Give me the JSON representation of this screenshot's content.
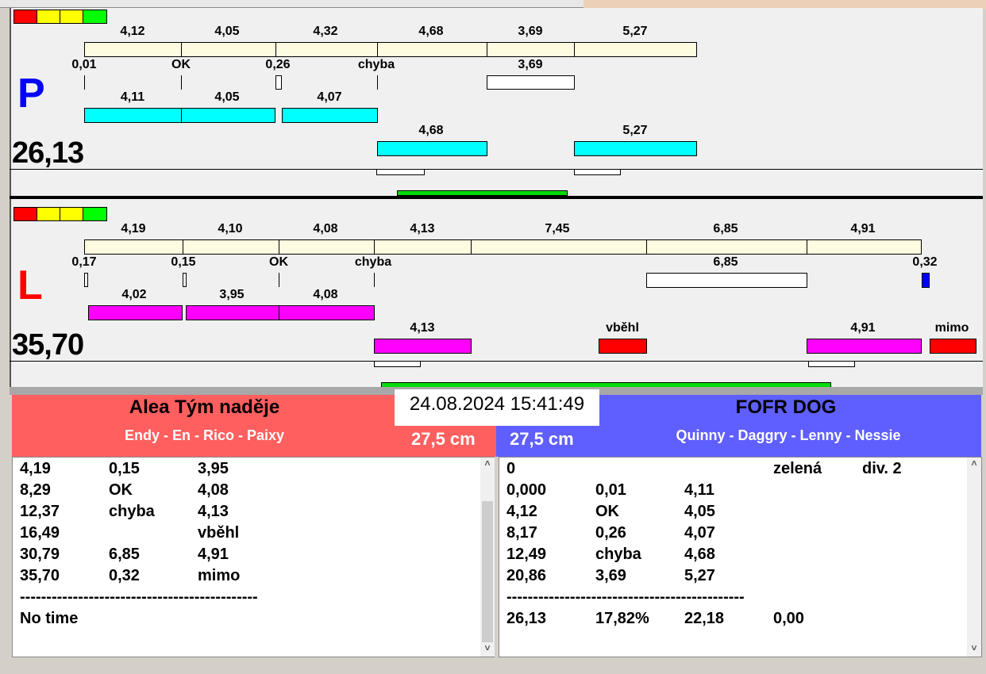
{
  "colors": {
    "cream": "#fffbe0",
    "cyan": "#00ffff",
    "magenta": "#ff00ff",
    "red": "#ff0000",
    "green": "#00dd00",
    "blue": "#0000ff",
    "team_left": "#ff5f5f",
    "team_right": "#5f5fff"
  },
  "p_panel": {
    "letter": "P",
    "total": "26,13",
    "top_labels": [
      "4,12",
      "4,05",
      "4,32",
      "4,68",
      "3,69",
      "5,27"
    ],
    "mid_labels": [
      "0,01",
      "OK",
      "0,26",
      "chyba",
      "3,69"
    ],
    "row1_labels": [
      "4,11",
      "4,05",
      "4,07"
    ],
    "row2_labels": [
      "4,68",
      "5,27"
    ]
  },
  "l_panel": {
    "letter": "L",
    "total": "35,70",
    "top_labels": [
      "4,19",
      "4,10",
      "4,08",
      "4,13",
      "7,45",
      "6,85",
      "4,91"
    ],
    "mid_labels": [
      "0,17",
      "0,15",
      "OK",
      "chyba",
      "6,85",
      "0,32"
    ],
    "row1_labels": [
      "4,02",
      "3,95",
      "4,08"
    ],
    "row2_labels": [
      "4,13",
      "vběhl",
      "4,91",
      "mimo"
    ]
  },
  "datetime": "24.08.2024 15:41:49",
  "left_team": {
    "name": "Alea Tým naděje",
    "players": "Endy - En - Rico - Paixy",
    "height": "27,5 cm",
    "rows": [
      [
        "4,19",
        "0,15",
        "3,95"
      ],
      [
        "8,29",
        "OK",
        "4,08"
      ],
      [
        "12,37",
        "chyba",
        "4,13"
      ],
      [
        "16,49",
        "",
        "vběhl"
      ],
      [
        "30,79",
        "6,85",
        "4,91"
      ],
      [
        "35,70",
        "0,32",
        "mimo"
      ]
    ],
    "separator": "---------------------------------------------",
    "footer": "No time"
  },
  "right_team": {
    "name": "FOFR DOG",
    "players": "Quinny - Daggry - Lenny - Nessie",
    "height": "27,5 cm",
    "header_row": [
      "0",
      "zelená",
      "div. 2"
    ],
    "rows": [
      [
        "0,000",
        "0,01",
        "4,11"
      ],
      [
        "4,12",
        "OK",
        "4,05"
      ],
      [
        "8,17",
        "0,26",
        "4,07"
      ],
      [
        "12,49",
        "chyba",
        "4,68"
      ],
      [
        "20,86",
        "3,69",
        "5,27"
      ]
    ],
    "separator": "---------------------------------------------",
    "footer": [
      "26,13",
      "17,82%",
      "22,18",
      "0,00"
    ]
  },
  "scroll": {
    "up": "˄",
    "down": "˅"
  }
}
